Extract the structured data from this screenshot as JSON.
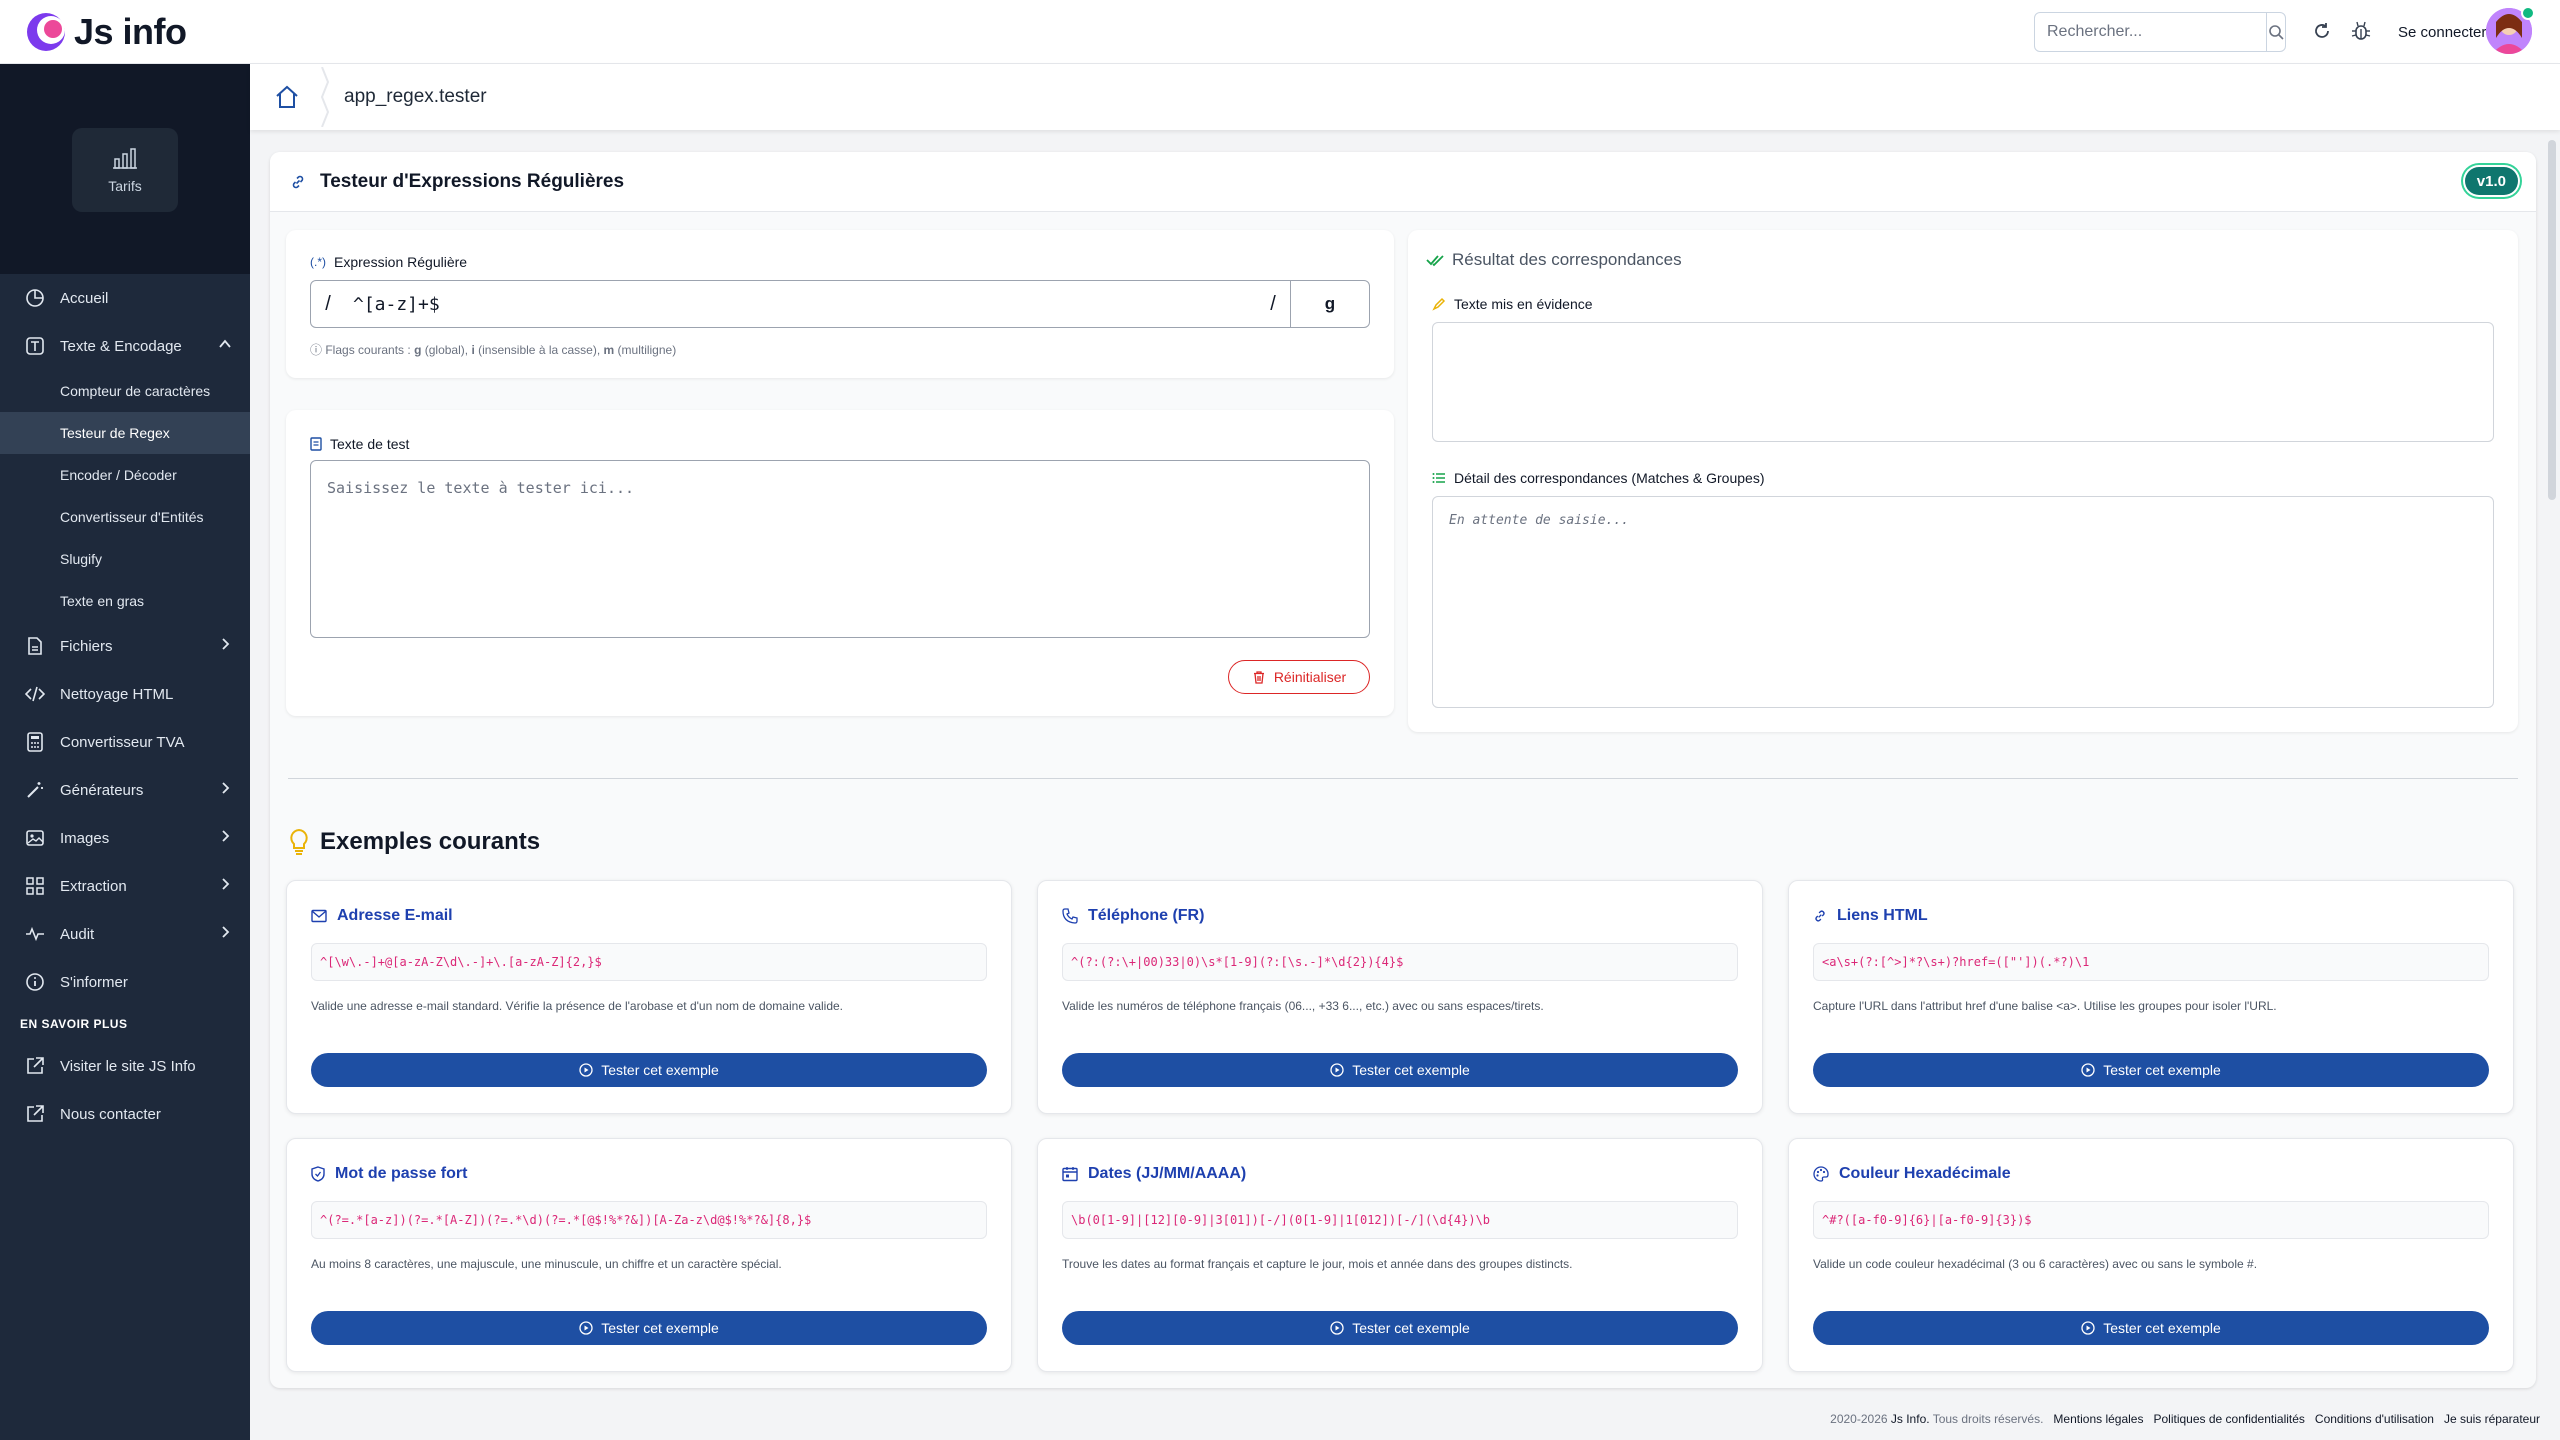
{
  "brand": {
    "name": "Js info"
  },
  "topbar": {
    "search_placeholder": "Rechercher...",
    "login_label": "Se connecter"
  },
  "sidebar": {
    "tarifs_label": "Tarifs",
    "items": [
      {
        "label": "Accueil",
        "icon": "pie-chart-icon"
      },
      {
        "label": "Texte & Encodage",
        "icon": "text-icon",
        "expanded": true
      },
      {
        "label": "Fichiers",
        "icon": "file-icon"
      },
      {
        "label": "Nettoyage HTML",
        "icon": "code-icon"
      },
      {
        "label": "Convertisseur TVA",
        "icon": "calculator-icon"
      },
      {
        "label": "Générateurs",
        "icon": "magic-wand-icon"
      },
      {
        "label": "Images",
        "icon": "image-icon"
      },
      {
        "label": "Extraction",
        "icon": "grid-icon"
      },
      {
        "label": "Audit",
        "icon": "pulse-icon"
      },
      {
        "label": "S'informer",
        "icon": "info-icon"
      }
    ],
    "subitems": [
      {
        "label": "Compteur de caractères"
      },
      {
        "label": "Testeur de Regex",
        "active": true
      },
      {
        "label": "Encoder / Décoder"
      },
      {
        "label": "Convertisseur d'Entités"
      },
      {
        "label": "Slugify"
      },
      {
        "label": "Texte en gras"
      }
    ],
    "section_title": "EN SAVOIR PLUS",
    "links": [
      {
        "label": "Visiter le site JS Info"
      },
      {
        "label": "Nous contacter"
      }
    ]
  },
  "breadcrumb": {
    "current": "app_regex.tester"
  },
  "tool": {
    "title": "Testeur d'Expressions Régulières",
    "version": "v1.0",
    "regex_label": "Expression Régulière",
    "regex_value": "^[a-z]+$",
    "flags_value": "g",
    "flags_hint_prefix": "Flags courants : ",
    "flags_hint_g": "g",
    "flags_hint_g_desc": " (global), ",
    "flags_hint_i": "i",
    "flags_hint_i_desc": " (insensible à la casse), ",
    "flags_hint_m": "m",
    "flags_hint_m_desc": " (multiligne)",
    "test_label": "Texte de test",
    "test_placeholder": "Saisissez le texte à tester ici...",
    "reset_label": "Réinitialiser",
    "result_title": "Résultat des correspondances",
    "highlight_label": "Texte mis en évidence",
    "detail_label": "Détail des correspondances (Matches & Groupes)",
    "detail_placeholder": "En attente de saisie..."
  },
  "examples": {
    "title": "Exemples courants",
    "button_label": "Tester cet exemple",
    "items": [
      {
        "title": "Adresse E-mail",
        "icon": "envelope-icon",
        "pattern": "^[\\w\\.-]+@[a-zA-Z\\d\\.-]+\\.[a-zA-Z]{2,}$",
        "desc": "Valide une adresse e-mail standard. Vérifie la présence de l'arobase et d'un nom de domaine valide."
      },
      {
        "title": "Téléphone (FR)",
        "icon": "phone-icon",
        "pattern": "^(?:(?:\\+|00)33|0)\\s*[1-9](?:[\\s.-]*\\d{2}){4}$",
        "desc": "Valide les numéros de téléphone français (06..., +33 6..., etc.) avec ou sans espaces/tirets."
      },
      {
        "title": "Liens HTML",
        "icon": "link-icon",
        "pattern": "<a\\s+(?:[^>]*?\\s+)?href=([\"'])(.*?)\\1",
        "desc": "Capture l'URL dans l'attribut href d'une balise <a>. Utilise les groupes pour isoler l'URL."
      },
      {
        "title": "Mot de passe fort",
        "icon": "shield-icon",
        "pattern": "^(?=.*[a-z])(?=.*[A-Z])(?=.*\\d)(?=.*[@$!%*?&])[A-Za-z\\d@$!%*?&]{8,}$",
        "desc": "Au moins 8 caractères, une majuscule, une minuscule, un chiffre et un caractère spécial."
      },
      {
        "title": "Dates (JJ/MM/AAAA)",
        "icon": "calendar-icon",
        "pattern": "\\b(0[1-9]|[12][0-9]|3[01])[-/](0[1-9]|1[012])[-/](\\d{4})\\b",
        "desc": "Trouve les dates au format français et capture le jour, mois et année dans des groupes distincts."
      },
      {
        "title": "Couleur Hexadécimale",
        "icon": "palette-icon",
        "pattern": "^#?([a-f0-9]{6}|[a-f0-9]{3})$",
        "desc": "Valide un code couleur hexadécimal (3 ou 6 caractères) avec ou sans le symbole #."
      }
    ]
  },
  "footer": {
    "copyright": "2020-2026",
    "brand": "Js Info.",
    "rights": "Tous droits réservés.",
    "links": [
      "Mentions légales",
      "Politiques de confidentialités",
      "Conditions d'utilisation",
      "Je suis réparateur"
    ]
  },
  "colors": {
    "sidebar": "#1e293b",
    "accent": "#1e4fa3",
    "danger": "#dc2626",
    "badge": "#0f766e"
  }
}
